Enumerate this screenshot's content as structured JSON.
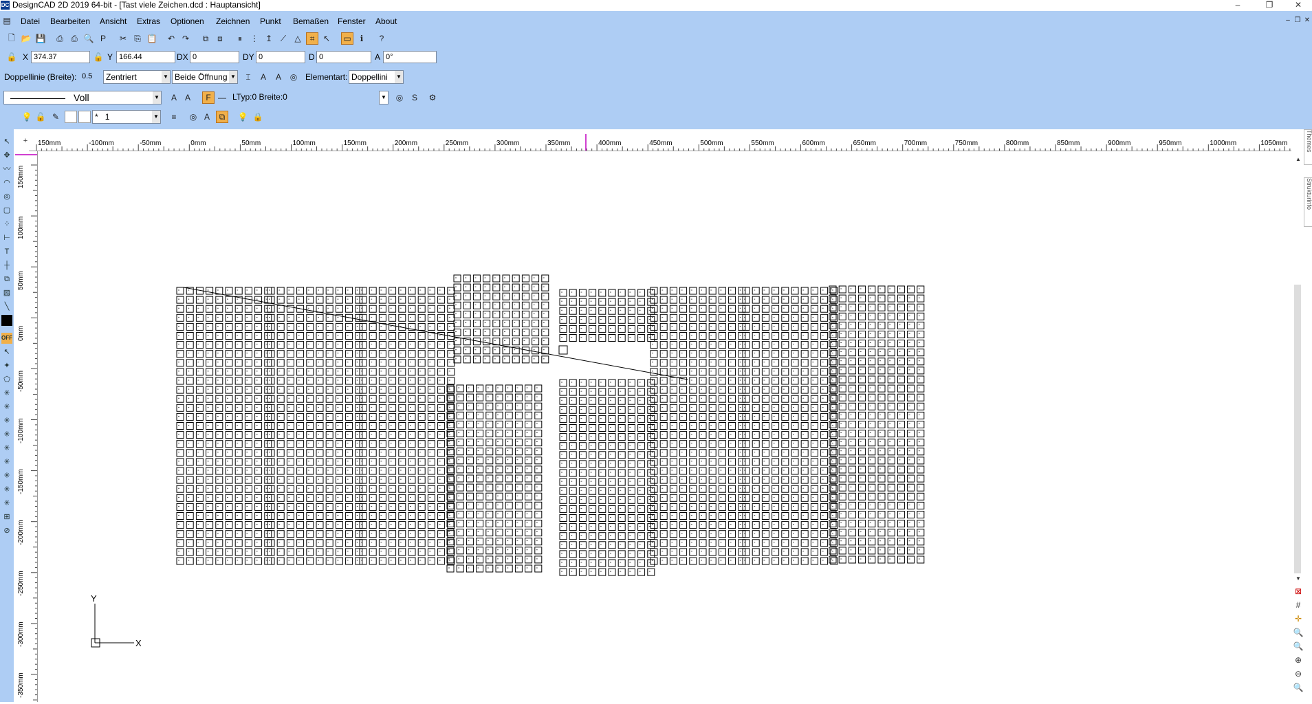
{
  "app": {
    "title": "DesignCAD 2D 2019 64-bit - [Tast viele Zeichen.dcd : Hauptansicht]",
    "icon": "designcad-app-icon"
  },
  "window_controls": {
    "minimize": "–",
    "restore": "❐",
    "close": "✕"
  },
  "menu": {
    "items": [
      "Datei",
      "Bearbeiten",
      "Ansicht",
      "Extras",
      "Optionen",
      "Zeichnen",
      "Punkt",
      "Bemaßen",
      "Fenster",
      "About"
    ]
  },
  "coords": {
    "x_label": "X",
    "x_value": "374.37",
    "y_label": "Y",
    "y_value": "166.44",
    "dx_label": "DX",
    "dx_value": "0",
    "dy_label": "DY",
    "dy_value": "0",
    "d_label": "D",
    "d_value": "0",
    "a_label": "A",
    "a_value": "0°"
  },
  "doubleline": {
    "label": "Doppellinie (Breite):",
    "width": "0.5",
    "align": "Zentriert",
    "opening": "Beide Öffnung",
    "element_label": "Elementart:",
    "element": "Doppellini"
  },
  "linestyle": {
    "name": "Voll",
    "info": "LTyp:0  Breite:0"
  },
  "layer": {
    "name": "1",
    "prefix": "*"
  },
  "ruler": {
    "horizontal": [
      "150mm",
      "-100mm",
      "-50mm",
      "0mm",
      "50mm",
      "100mm",
      "150mm",
      "200mm",
      "250mm",
      "300mm",
      "350mm",
      "400mm",
      "450mm",
      "500mm",
      "550mm",
      "600mm",
      "650mm",
      "700mm",
      "750mm",
      "800mm",
      "850mm",
      "900mm",
      "950mm",
      "1000mm",
      "1050mm"
    ],
    "vertical": [
      "150mm",
      "100mm",
      "50mm",
      "0mm",
      "-50mm",
      "-100mm",
      "-150mm",
      "-200mm",
      "-250mm",
      "-300mm",
      "-350mm"
    ]
  },
  "side_tabs": [
    "Themes",
    "Strukturinfo"
  ],
  "axis": {
    "y": "Y",
    "x": "X"
  },
  "colors": {
    "chrome": "#aecdf4",
    "active_button": "#f1b04a",
    "cursor_marker": "#c000c0"
  }
}
